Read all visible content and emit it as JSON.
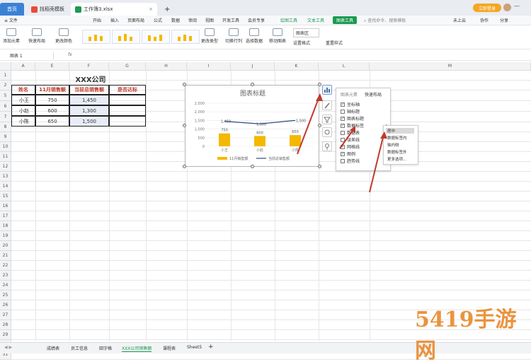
{
  "titlebar": {
    "home_tab": "首页",
    "template_tab": "找稻壳模板",
    "workbook_tab": "工作簿3.xlsx",
    "add_tab": "+",
    "login": "立即登录"
  },
  "menubar": {
    "file": "≡ 文件",
    "items": [
      "开始",
      "插入",
      "页面布局",
      "公式",
      "数据",
      "审阅",
      "视图",
      "开发工具",
      "会员专享"
    ],
    "drawing_tools": "绘图工具",
    "text_tools": "文本工具",
    "chart_tools": "图表工具",
    "search": "查找命令、搜索模板",
    "cloud": "未上云",
    "collab": "协作",
    "share": "分享"
  },
  "ribbon": {
    "add_element": "添加元素",
    "quick_layout": "快速布局",
    "change_color": "更改颜色",
    "change_type": "更改类型",
    "switch_rowcol": "切换行列",
    "select_data": "选择数据",
    "move_chart": "移动图表",
    "chart_area": "图表区",
    "format_setting": "设置格式",
    "reset_style": "重置样式"
  },
  "formula": {
    "namebox": "图表 1",
    "fx": "fx"
  },
  "grid": {
    "columns": [
      "A",
      "E",
      "F",
      "G",
      "H",
      "I",
      "J",
      "K",
      "L",
      "M"
    ],
    "rows": [
      "1",
      "2",
      "5",
      "6",
      "7",
      "8",
      "9",
      "10",
      "11",
      "12",
      "13",
      "14",
      "15",
      "16",
      "17",
      "18",
      "19",
      "20",
      "21",
      "22",
      "23",
      "24",
      "25",
      "26",
      "27",
      "28",
      "29",
      "30",
      "31"
    ],
    "company_title": "XXX公司",
    "headers": [
      "姓名",
      "11月销售额",
      "当前总销售额",
      "是否达标"
    ],
    "data": [
      {
        "name": "小王",
        "nov": "750",
        "total": "1,450"
      },
      {
        "name": "小赵",
        "nov": "600",
        "total": "1,300"
      },
      {
        "name": "小陈",
        "nov": "650",
        "total": "1,500"
      }
    ]
  },
  "chart_data": {
    "type": "bar",
    "title": "图表标题",
    "categories": [
      "小王",
      "小赵",
      "小陈"
    ],
    "series": [
      {
        "name": "11月销售额",
        "type": "bar",
        "values": [
          750,
          600,
          650
        ],
        "color": "#f5b800"
      },
      {
        "name": "当前总销售额",
        "type": "line",
        "values": [
          1450,
          1300,
          1500
        ],
        "color": "#2e4a7d"
      }
    ],
    "yticks": [
      "0",
      "500",
      "1,000",
      "1,500",
      "2,000",
      "2,500"
    ],
    "ylim": [
      0,
      2500
    ],
    "bar_labels": [
      "750",
      "600",
      "650"
    ],
    "line_labels": [
      "1,450",
      "1,300",
      "1,500"
    ],
    "legend_placement": "bottom",
    "grid": true
  },
  "panel": {
    "tab_elements": "图表元素",
    "tab_layout": "快速布局",
    "items": [
      {
        "label": "坐标轴",
        "checked": true
      },
      {
        "label": "轴标题",
        "checked": false
      },
      {
        "label": "图表标题",
        "checked": true
      },
      {
        "label": "数据标签",
        "checked": true
      },
      {
        "label": "数据表",
        "checked": false
      },
      {
        "label": "误差线",
        "checked": false
      },
      {
        "label": "网格线",
        "checked": true
      },
      {
        "label": "图例",
        "checked": true
      },
      {
        "label": "趋势线",
        "checked": false
      }
    ]
  },
  "submenu": {
    "items": [
      "居中",
      "数据标签内",
      "轴内侧",
      "数据标签外",
      "更多选项..."
    ]
  },
  "sheets": {
    "tabs": [
      "成绩表",
      "员工信息",
      "田字格",
      "XXX公司销售额",
      "课程表",
      "Sheet5"
    ],
    "active": "XXX公司销售额",
    "add": "+"
  },
  "watermark": "5419手游网"
}
